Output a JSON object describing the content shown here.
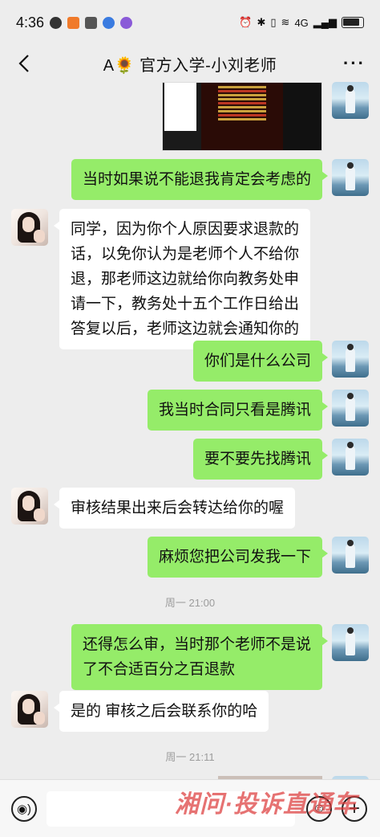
{
  "status_bar": {
    "time": "4:36",
    "network": "4G",
    "battery_icon": "battery-icon"
  },
  "header": {
    "back_icon": "chevron-left-icon",
    "title": "A🌻 官方入学-小刘老师",
    "more_icon": "more-dots-icon"
  },
  "messages": [
    {
      "from": "me",
      "type": "image"
    },
    {
      "from": "me",
      "text": "当时如果说不能退我肯定会考虑的"
    },
    {
      "from": "teacher",
      "text": "同学，因为你个人原因要求退款的\n话，以免你认为是老师个人不给你\n退，那老师这边就给你向教务处申\n请一下，教务处十五个工作日给出\n答复以后，老师这边就会通知你的"
    },
    {
      "from": "me",
      "text": "你们是什么公司"
    },
    {
      "from": "me",
      "text": "我当时合同只看是腾讯"
    },
    {
      "from": "me",
      "text": "要不要先找腾讯"
    },
    {
      "from": "teacher",
      "text": "审核结果出来后会转达给你的喔"
    },
    {
      "from": "me",
      "text": "麻烦您把公司发我一下"
    },
    {
      "type": "time",
      "text": "周一 21:00"
    },
    {
      "from": "me",
      "text": "还得怎么审，当时那个老师不是说\n了不合适百分之百退款"
    },
    {
      "from": "teacher",
      "text": "是的  审核之后会联系你的哈"
    },
    {
      "type": "time",
      "text": "周一 21:11"
    }
  ],
  "input_bar": {
    "voice_icon": "voice-icon",
    "input_value": "",
    "emoji_icon": "emoji-icon",
    "plus_icon": "plus-icon"
  },
  "watermark": "湘问·投诉直通车",
  "colors": {
    "background": "#ededed",
    "my_bubble": "#95ec69",
    "their_bubble": "#ffffff",
    "watermark": "#dc3c3c"
  }
}
